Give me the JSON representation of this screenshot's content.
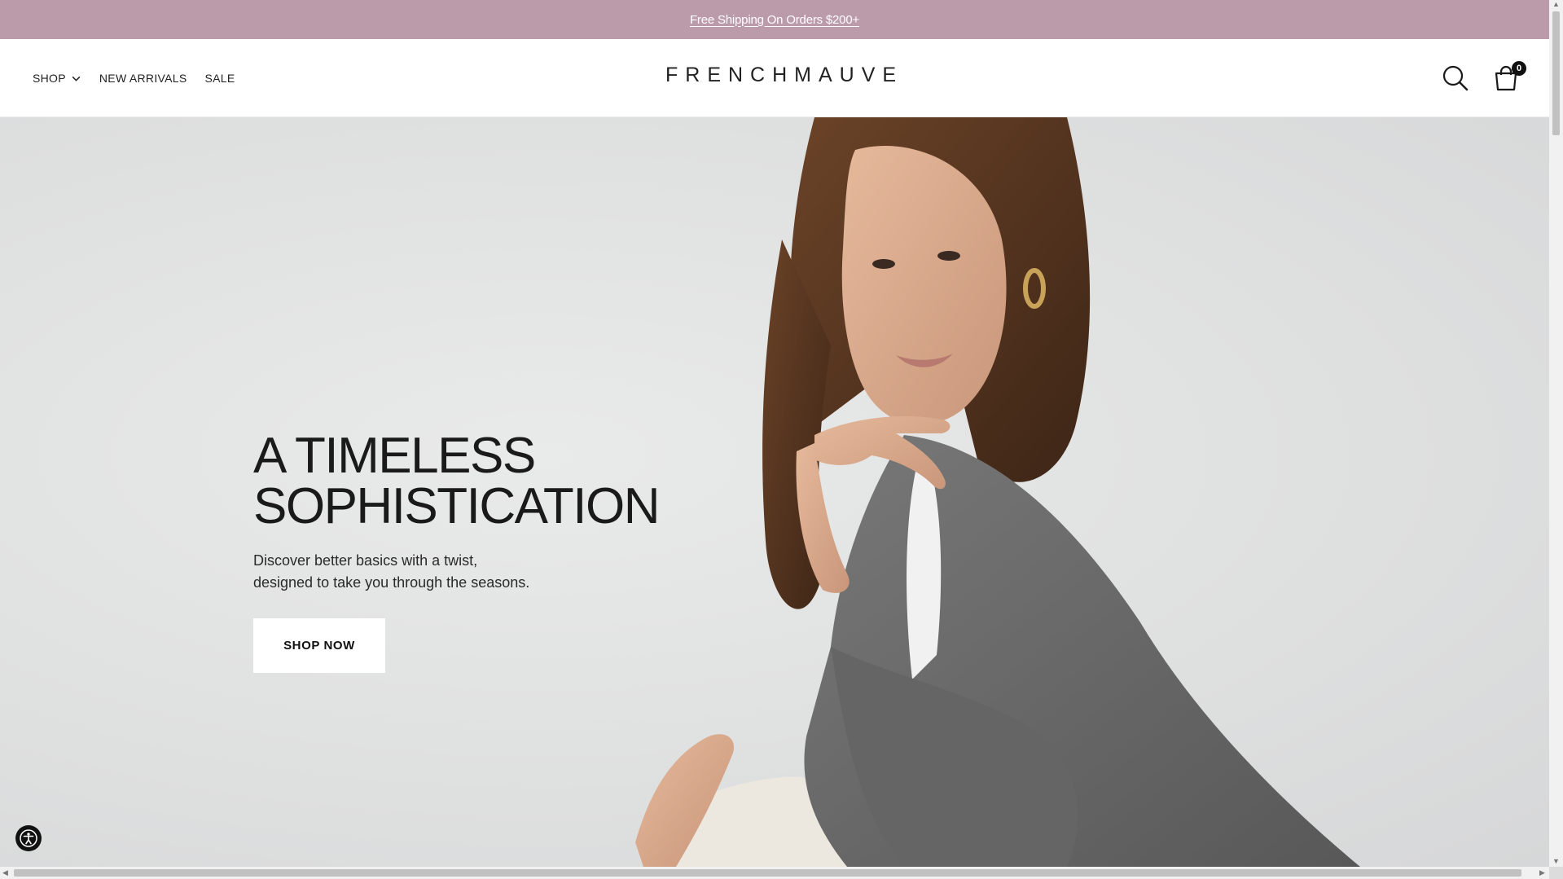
{
  "announcement": {
    "text": "Free Shipping On Orders $200+"
  },
  "header": {
    "nav": [
      {
        "label": "SHOP",
        "has_dropdown": true
      },
      {
        "label": "NEW ARRIVALS"
      },
      {
        "label": "SALE"
      }
    ],
    "logo": "FRENCHMAUVE",
    "cart_count": "0",
    "icons": [
      "search-icon",
      "shopping-bag-icon"
    ]
  },
  "hero": {
    "title_line1": "A TIMELESS",
    "title_line2": "SOPHISTICATION",
    "subtitle_line1": "Discover better basics with a twist,",
    "subtitle_line2": "designed to take you through the seasons.",
    "cta": "SHOP NOW"
  },
  "colors": {
    "brand_mauve": "#bb9aaa",
    "text": "#1a1a1a",
    "hero_bg": "#e0e1e1",
    "blazer": "#6b6b6b"
  },
  "accessibility": {
    "icon": "accessibility-icon"
  }
}
